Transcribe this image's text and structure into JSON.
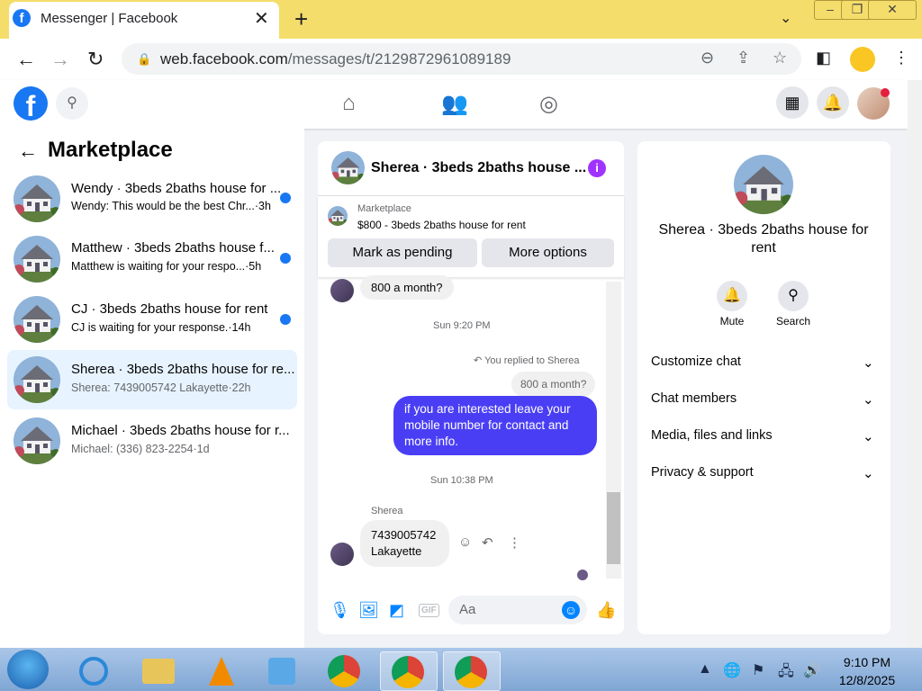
{
  "browser": {
    "tab_title": "Messenger | Facebook",
    "tab_close": "✕",
    "new_tab": "+",
    "url_domain": "web.facebook.com",
    "url_path": "/messages/t/2129872961089189"
  },
  "left": {
    "title": "Marketplace",
    "conversations": [
      {
        "name": "Wendy · 3beds 2baths house for ...",
        "preview": "Wendy: This would be the best Chr...",
        "time": "·3h",
        "unread": true
      },
      {
        "name": "Matthew · 3beds 2baths house f...",
        "preview": "Matthew is waiting for your respo...",
        "time": "·5h",
        "unread": true
      },
      {
        "name": "CJ · 3beds 2baths house for rent",
        "preview": "CJ is waiting for your response.",
        "time": "·14h",
        "unread": true
      },
      {
        "name": "Sherea · 3beds 2baths house for re...",
        "preview": "Sherea: 7439005742 Lakayette",
        "time": "·22h",
        "unread": false
      },
      {
        "name": "Michael · 3beds 2baths house for r...",
        "preview": "Michael: (336) 823-2254",
        "time": "·1d",
        "unread": false
      }
    ]
  },
  "chat": {
    "title": "Sherea · 3beds 2baths house ...",
    "info_icon": "i",
    "listing_source": "Marketplace",
    "listing": "$800 - 3beds 2baths house for rent",
    "btn_pending": "Mark as pending",
    "btn_more": "More options",
    "msg1": "800 a month?",
    "ts1": "Sun 9:20 PM",
    "replied": "You replied to Sherea",
    "quoted": "800 a month?",
    "my_msg": "if  you are  interested leave your mobile number for contact and more info.",
    "ts2": "Sun 10:38 PM",
    "sender": "Sherea",
    "msg2_line1": "7439005742",
    "msg2_line2": "Lakayette",
    "composer_placeholder": "Aa"
  },
  "right": {
    "title": "Sherea · 3beds 2baths house for rent",
    "mute": "Mute",
    "search": "Search",
    "rows": [
      "Customize chat",
      "Chat members",
      "Media, files and links",
      "Privacy & support"
    ]
  },
  "taskbar": {
    "time": "9:10 PM",
    "date": "12/8/2025"
  },
  "colors": {
    "accent": "#1877f2",
    "bubble_blue": "#4a3ef5",
    "selected_row": "#e7f3ff",
    "tab_strip": "#f5dd6b"
  }
}
